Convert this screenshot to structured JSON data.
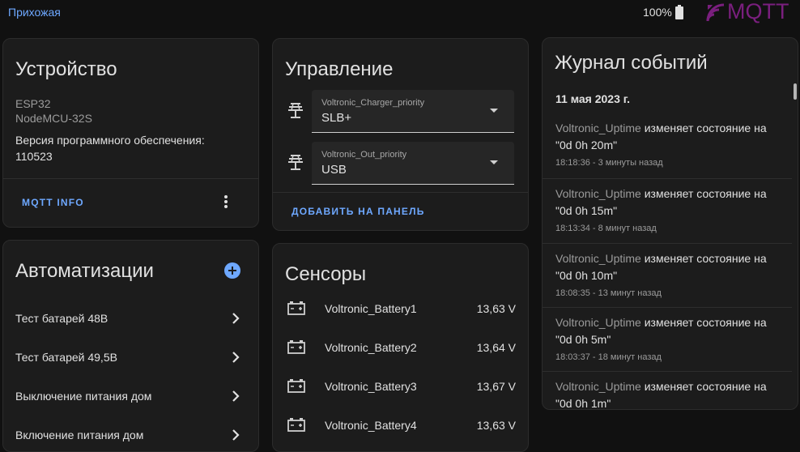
{
  "topbar": {
    "breadcrumb": "Прихожая",
    "battery_level": "100%",
    "brand_text": "MQTT",
    "brand_color": "#7a1f7e"
  },
  "device": {
    "title": "Устройство",
    "model": "ESP32",
    "manufacturer": "NodeMCU-32S",
    "firmware_label": "Версия программного обеспечения:",
    "firmware_value": "110523",
    "mqtt_info_label": "MQTT INFO"
  },
  "automations": {
    "title": "Автоматизации",
    "items": [
      {
        "label": "Тест батарей 48В"
      },
      {
        "label": "Тест батарей 49,5В"
      },
      {
        "label": "Выключение питания дом"
      },
      {
        "label": "Включение питания дом"
      }
    ]
  },
  "controls": {
    "title": "Управление",
    "selects": [
      {
        "label": "Voltronic_Charger_priority",
        "value": "SLB+",
        "icon": "solar-power-icon"
      },
      {
        "label": "Voltronic_Out_priority",
        "value": "USB",
        "icon": "solar-power-icon"
      }
    ],
    "add_to_panel_label": "ДОБАВИТЬ НА ПАНЕЛЬ"
  },
  "sensors": {
    "title": "Сенсоры",
    "items": [
      {
        "name": "Voltronic_Battery1",
        "value": "13,63 V",
        "icon": "car-battery-icon"
      },
      {
        "name": "Voltronic_Battery2",
        "value": "13,64 V",
        "icon": "car-battery-icon"
      },
      {
        "name": "Voltronic_Battery3",
        "value": "13,67 V",
        "icon": "car-battery-icon"
      },
      {
        "name": "Voltronic_Battery4",
        "value": "13,63 V",
        "icon": "car-battery-icon"
      }
    ]
  },
  "logbook": {
    "title": "Журнал событий",
    "date": "11 мая 2023 г.",
    "entries": [
      {
        "entity": "Voltronic_Uptime",
        "action": "изменяет состояние на",
        "state": "\"0d 0h 20m\"",
        "time": "18:18:36 - 3 минуты назад"
      },
      {
        "entity": "Voltronic_Uptime",
        "action": "изменяет состояние на",
        "state": "\"0d 0h 15m\"",
        "time": "18:13:34 - 8 минут назад"
      },
      {
        "entity": "Voltronic_Uptime",
        "action": "изменяет состояние на",
        "state": "\"0d 0h 10m\"",
        "time": "18:08:35 - 13 минут назад"
      },
      {
        "entity": "Voltronic_Uptime",
        "action": "изменяет состояние на",
        "state": "\"0d 0h 5m\"",
        "time": "18:03:37 - 18 минут назад"
      },
      {
        "entity": "Voltronic_Uptime",
        "action": "изменяет состояние на",
        "state": "\"0d 0h 1m\"",
        "time": ""
      }
    ]
  },
  "colors": {
    "accent": "#6ea8ff",
    "card_bg": "#1c1c1c",
    "page_bg": "#111111"
  }
}
